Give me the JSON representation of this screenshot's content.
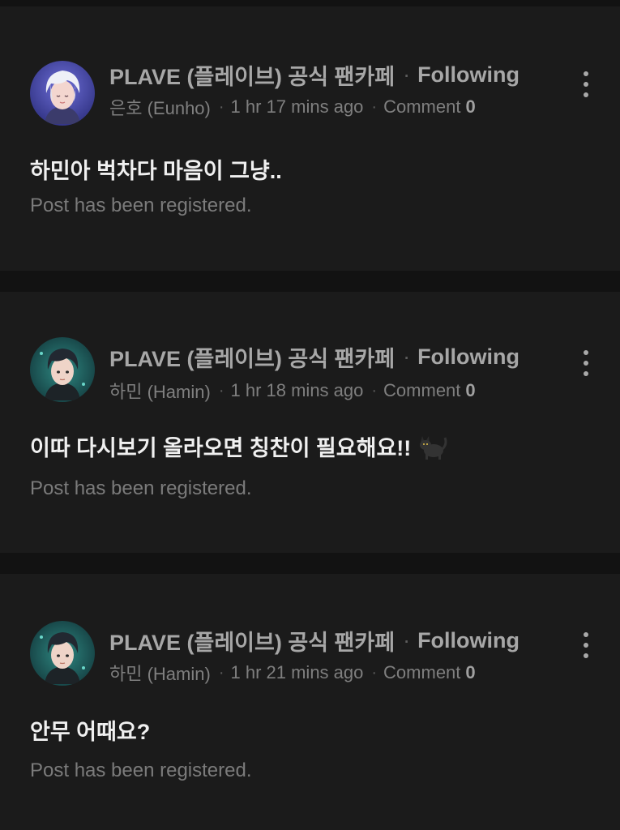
{
  "colors": {
    "page_background": "#121212",
    "card_background": "#1b1b1b",
    "primary_text": "#f0f0f0",
    "secondary_text": "#7f7f7f",
    "muted_text": "#a7a7a7"
  },
  "posts": [
    {
      "cafe_name": "PLAVE (플레이브) 공식 팬카페",
      "separator": "·",
      "follow_label": "Following",
      "author": "은호 (Eunho)",
      "time": "1 hr 17 mins ago",
      "comment_label": "Comment",
      "comment_count": "0",
      "title": "하민아 벅차다 마음이 그냥..",
      "status": "Post has been registered.",
      "avatar_icon": "avatar-eunho",
      "more_icon": "more-vertical-icon"
    },
    {
      "cafe_name": "PLAVE (플레이브) 공식 팬카페",
      "separator": "·",
      "follow_label": "Following",
      "author": "하민 (Hamin)",
      "time": "1 hr 18 mins ago",
      "comment_label": "Comment",
      "comment_count": "0",
      "title": "이따 다시보기 올라오면 칭찬이 필요해요!!",
      "title_emoji": "black-cat-emoji",
      "status": "Post has been registered.",
      "avatar_icon": "avatar-hamin",
      "more_icon": "more-vertical-icon"
    },
    {
      "cafe_name": "PLAVE (플레이브) 공식 팬카페",
      "separator": "·",
      "follow_label": "Following",
      "author": "하민 (Hamin)",
      "time": "1 hr 21 mins ago",
      "comment_label": "Comment",
      "comment_count": "0",
      "title": "안무 어때요?",
      "status": "Post has been registered.",
      "avatar_icon": "avatar-hamin",
      "more_icon": "more-vertical-icon"
    }
  ]
}
